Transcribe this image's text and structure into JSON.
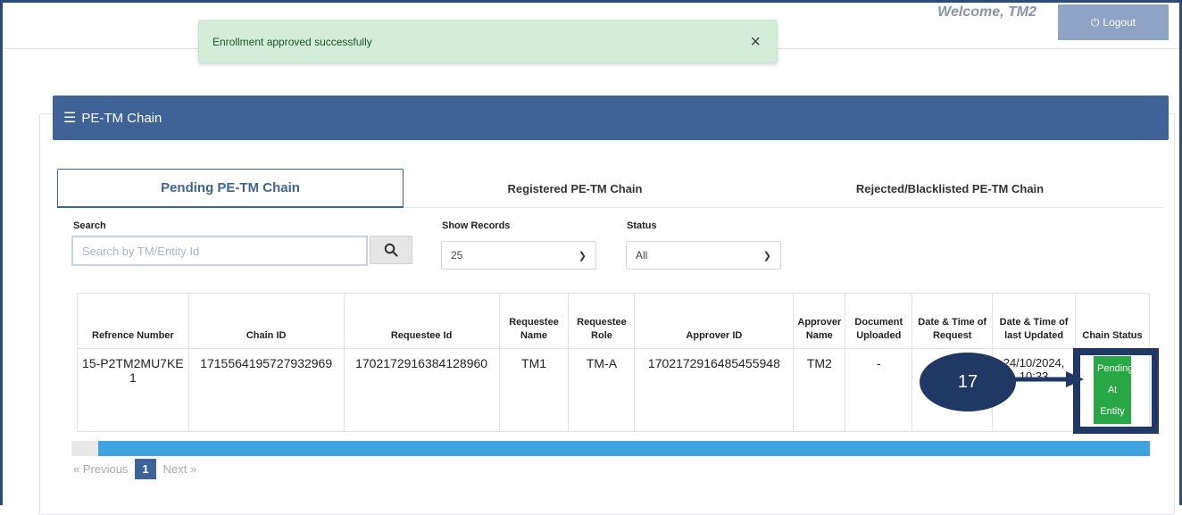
{
  "header": {
    "welcome": "Welcome, TM2",
    "logout": "Logout"
  },
  "toast": {
    "message": "Enrollment approved successfully",
    "close": "×"
  },
  "panel": {
    "title": "PE-TM Chain"
  },
  "tabs": [
    {
      "label": "Pending PE-TM Chain",
      "active": true
    },
    {
      "label": "Registered PE-TM Chain",
      "active": false
    },
    {
      "label": "Rejected/Blacklisted PE-TM Chain",
      "active": false
    }
  ],
  "filters": {
    "search_label": "Search",
    "search_placeholder": "Search by TM/Entity Id",
    "records_label": "Show Records",
    "records_value": "25",
    "status_label": "Status",
    "status_value": "All"
  },
  "table": {
    "headers": [
      "Refrence Number",
      "Chain ID",
      "Requestee Id",
      "Requestee Name",
      "Requestee Role",
      "Approver ID",
      "Approver Name",
      "Document Uploaded",
      "Date & Time of Request",
      "Date & Time of last Updated",
      "Chain Status"
    ],
    "rows": [
      {
        "ref": "15-P2TM2MU7KE1",
        "chain_id": "1715564195727932969",
        "requestee_id": "1702172916384128960",
        "requestee_name": "TM1",
        "requestee_role": "TM-A",
        "approver_id": "1702172916485455948",
        "approver_name": "TM2",
        "document": "-",
        "request_time": "",
        "updated_time": "24/10/2024, 10:33",
        "status": "Pending At Entity"
      }
    ]
  },
  "pager": {
    "prev": "« Previous",
    "current": "1",
    "next": "Next »"
  },
  "annotation": {
    "number": "17"
  }
}
